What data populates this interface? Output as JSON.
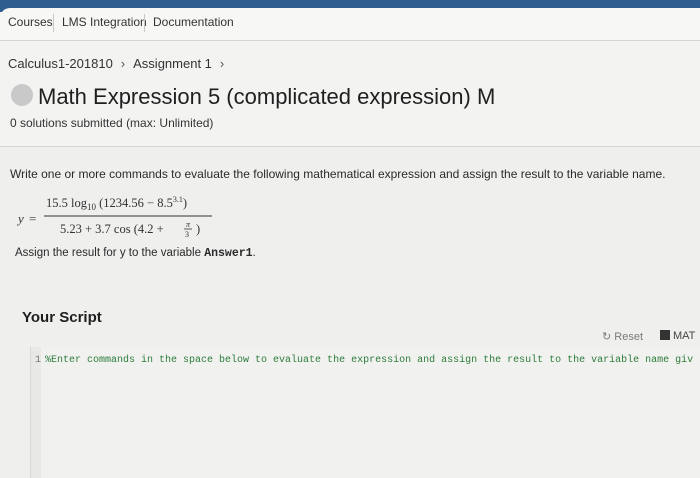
{
  "nav": {
    "tabs": [
      {
        "label": "Courses"
      },
      {
        "label": "LMS Integration"
      },
      {
        "label": "Documentation"
      }
    ]
  },
  "breadcrumb": {
    "course": "Calculus1-201810",
    "assignment": "Assignment 1"
  },
  "problem": {
    "title": "Math Expression 5 (complicated expression) M",
    "submissions": "0 solutions submitted (max: Unlimited)",
    "instruction": "Write one or more commands to evaluate the following mathematical expression and assign the result to the variable name.",
    "formula": {
      "lhs": "y",
      "numerator": "15.5 log10 (1234.56 − 8.5^3.1)",
      "denominator": "5.23 + 3.7 cos (4.2 + π/3)"
    },
    "assign_note_prefix": "Assign the result for y to the variable",
    "assign_var": "Answer1",
    "assign_note_suffix": "."
  },
  "script": {
    "heading": "Your Script",
    "reset_label": "Reset",
    "matlab_label": "MAT",
    "line_number": "1",
    "line_text": "%Enter commands in the space below to evaluate the expression and assign the result to the variable name giv"
  }
}
